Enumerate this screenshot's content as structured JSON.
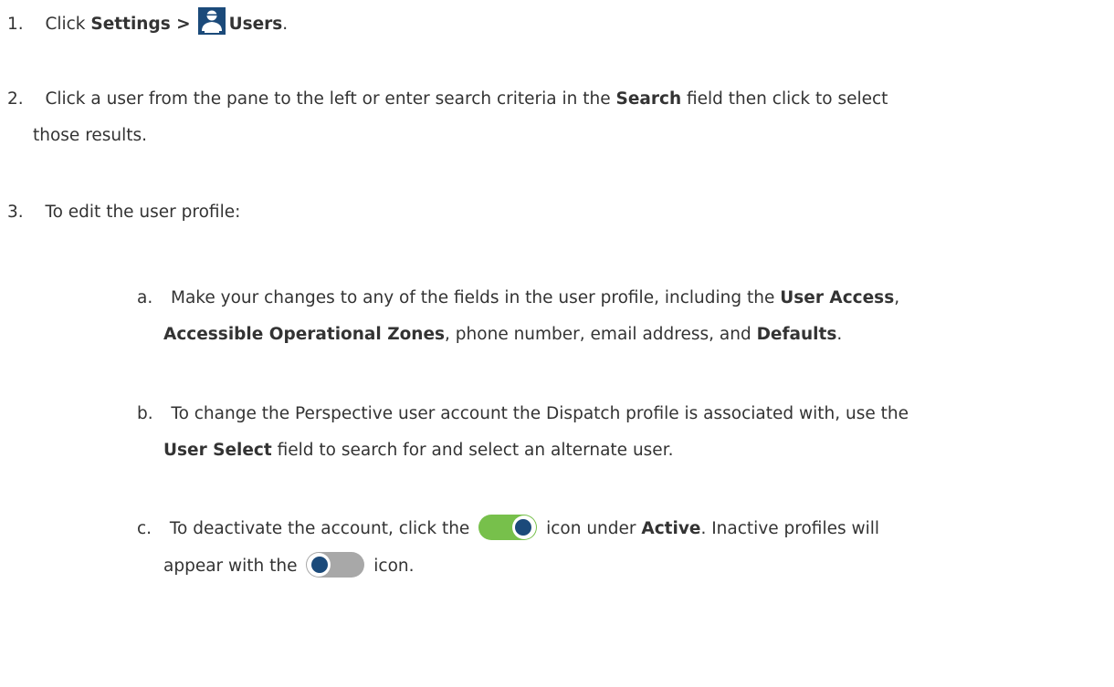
{
  "steps": [
    {
      "number": "1.",
      "text_before": "Click ",
      "bold1": "Settings >",
      "icon": "users-icon",
      "bold2": "Users",
      "text_after": "."
    },
    {
      "number": "2.",
      "line1_before": "Click a user from the pane to the left or enter search criteria in the ",
      "line1_bold": "Search",
      "line1_after": " field then click to select",
      "line2": "those results."
    },
    {
      "number": "3.",
      "text": "To edit the user profile:"
    }
  ],
  "substeps": [
    {
      "letter": "a.",
      "line1_before": "Make your changes to any of the fields in the user profile, including the ",
      "line1_bold": "User Access",
      "line1_after": ",",
      "line2_bold1": "Accessible Operational Zones",
      "line2_mid": ", phone number, email address, and ",
      "line2_bold2": "Defaults",
      "line2_after": "."
    },
    {
      "letter": "b.",
      "line1": "To change the Perspective user account the Dispatch profile is associated with, use the",
      "line2_bold": "User Select",
      "line2_after": " field to search for and select an alternate user."
    },
    {
      "letter": "c.",
      "line1_before": "To deactivate the account, click the ",
      "line1_mid": " icon under ",
      "line1_bold": "Active",
      "line1_after": ". Inactive profiles will",
      "line2_before": "appear with the ",
      "line2_after": " icon."
    }
  ],
  "colors": {
    "text": "#333333",
    "toggle_on": "#77c04b",
    "toggle_off": "#a8a8a8",
    "knob_inner": "#1b4a7a",
    "icon_navy": "#1b4a7a"
  }
}
